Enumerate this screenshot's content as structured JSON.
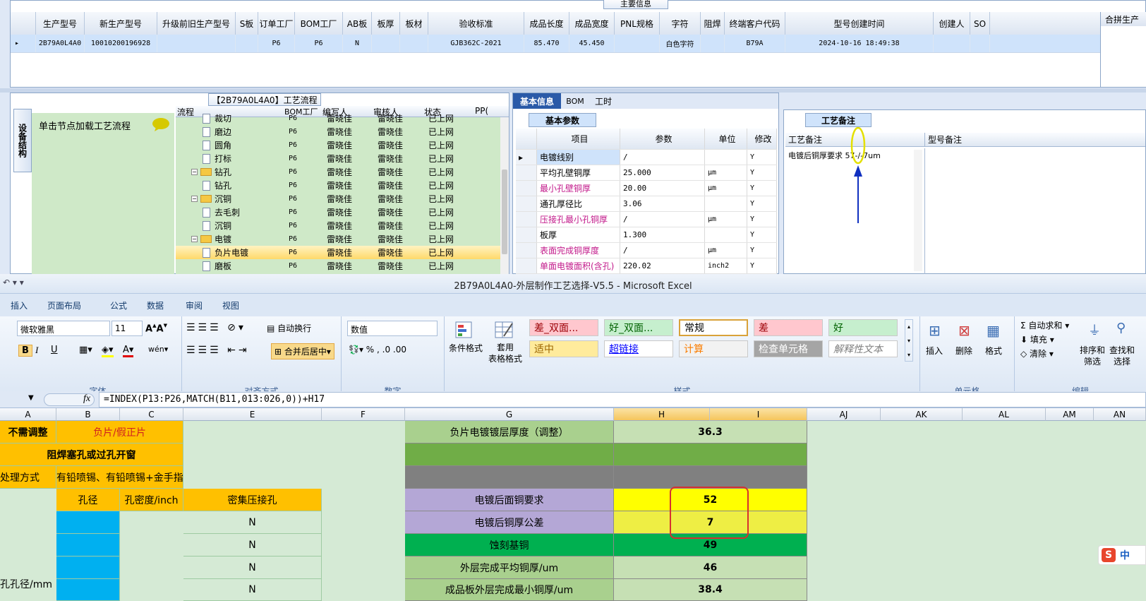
{
  "top_grid": {
    "panel_title": "主要信息",
    "headers": [
      "生产型号",
      "新生产型号",
      "升级前旧生产型号",
      "S板",
      "订单工厂",
      "BOM工厂",
      "AB板",
      "板厚",
      "板材",
      "验收标准",
      "成品长度",
      "成品宽度",
      "PNL规格",
      "字符",
      "阻焊",
      "终端客户代码",
      "型号创建时间",
      "创建人",
      "SO"
    ],
    "row": [
      "2B79A0L4A0",
      "10010200196928",
      "",
      "",
      "P6",
      "P6",
      "N",
      "",
      "",
      "GJB362C-2021",
      "85.470",
      "45.450",
      "",
      "白色字符",
      "",
      "B79A",
      "2024-10-16 18:49:38",
      "",
      ""
    ],
    "right_header": "合拼生产"
  },
  "flow": {
    "title": "【2B79A0L4A0】工艺流程",
    "side_tab": "设备结构",
    "hint": "单击节点加载工艺流程",
    "headers": [
      "流程",
      "BOM工厂",
      "编写人",
      "审核人",
      "状态",
      "PP("
    ],
    "rows": [
      {
        "name": "裁切",
        "bom": "P6",
        "writer": "雷晓佳",
        "reviewer": "雷晓佳",
        "status": "已上网",
        "type": "doc",
        "level": 2
      },
      {
        "name": "磨边",
        "bom": "P6",
        "writer": "雷晓佳",
        "reviewer": "雷晓佳",
        "status": "已上网",
        "type": "doc",
        "level": 2
      },
      {
        "name": "圆角",
        "bom": "P6",
        "writer": "雷晓佳",
        "reviewer": "雷晓佳",
        "status": "已上网",
        "type": "doc",
        "level": 2
      },
      {
        "name": "打标",
        "bom": "P6",
        "writer": "雷晓佳",
        "reviewer": "雷晓佳",
        "status": "已上网",
        "type": "doc",
        "level": 2
      },
      {
        "name": "钻孔",
        "bom": "P6",
        "writer": "雷晓佳",
        "reviewer": "雷晓佳",
        "status": "已上网",
        "type": "folder",
        "level": 1
      },
      {
        "name": "钻孔",
        "bom": "P6",
        "writer": "雷晓佳",
        "reviewer": "雷晓佳",
        "status": "已上网",
        "type": "doc",
        "level": 2
      },
      {
        "name": "沉铜",
        "bom": "P6",
        "writer": "雷晓佳",
        "reviewer": "雷晓佳",
        "status": "已上网",
        "type": "folder",
        "level": 1
      },
      {
        "name": "去毛刺",
        "bom": "P6",
        "writer": "雷晓佳",
        "reviewer": "雷晓佳",
        "status": "已上网",
        "type": "doc",
        "level": 2
      },
      {
        "name": "沉铜",
        "bom": "P6",
        "writer": "雷晓佳",
        "reviewer": "雷晓佳",
        "status": "已上网",
        "type": "doc",
        "level": 2
      },
      {
        "name": "电镀",
        "bom": "P6",
        "writer": "雷晓佳",
        "reviewer": "雷晓佳",
        "status": "已上网",
        "type": "folder",
        "level": 1
      },
      {
        "name": "负片电镀",
        "bom": "P6",
        "writer": "雷晓佳",
        "reviewer": "雷晓佳",
        "status": "已上网",
        "type": "doc",
        "level": 2
      },
      {
        "name": "磨板",
        "bom": "P6",
        "writer": "雷晓佳",
        "reviewer": "雷晓佳",
        "status": "已上网",
        "type": "doc",
        "level": 2
      }
    ]
  },
  "info": {
    "tabs": [
      "基本信息",
      "BOM",
      "工时"
    ],
    "subtab": "基本参数",
    "headers": [
      "项目",
      "参数",
      "单位",
      "修改"
    ],
    "rows": [
      {
        "item": "电镀线别",
        "param": "/",
        "unit": "",
        "mod": "Y",
        "pink": false
      },
      {
        "item": "平均孔壁铜厚",
        "param": "25.000",
        "unit": "μm",
        "mod": "Y",
        "pink": false
      },
      {
        "item": "最小孔壁铜厚",
        "param": "20.00",
        "unit": "μm",
        "mod": "Y",
        "pink": true
      },
      {
        "item": "通孔厚径比",
        "param": "3.06",
        "unit": "",
        "mod": "Y",
        "pink": false
      },
      {
        "item": "压接孔最小孔铜厚",
        "param": "/",
        "unit": "μm",
        "mod": "Y",
        "pink": true
      },
      {
        "item": "板厚",
        "param": "1.300",
        "unit": "",
        "mod": "Y",
        "pink": false
      },
      {
        "item": "表面完成铜厚度",
        "param": "/",
        "unit": "μm",
        "mod": "Y",
        "pink": true
      },
      {
        "item": "单面电镀面积(含孔)",
        "param": "220.02",
        "unit": "inch2",
        "mod": "Y",
        "pink": true
      }
    ]
  },
  "notes": {
    "tab": "工艺备注",
    "col1": "工艺备注",
    "col2": "型号备注",
    "text": "电镀后铜厚要求 57-/-7um"
  },
  "excel": {
    "title": "2B79A0L4A0-外层制作工艺选择-V5.5 - Microsoft Excel",
    "ribbon_tabs": [
      "插入",
      "页面布局",
      "公式",
      "数据",
      "审阅",
      "视图"
    ],
    "font_name": "微软雅黑",
    "font_size": "11",
    "wrap": "自动换行",
    "merge": "合并后居中",
    "number_format": "数值",
    "cond_format": "条件格式",
    "table_format": "套用\n表格格式",
    "styles": [
      {
        "t": "差_双面...",
        "bg": "#ffc7ce",
        "c": "#9c0006"
      },
      {
        "t": "好_双面...",
        "bg": "#c6efce",
        "c": "#006100"
      },
      {
        "t": "常规",
        "bg": "#ffffff",
        "c": "#000000"
      },
      {
        "t": "差",
        "bg": "#ffc7ce",
        "c": "#9c0006"
      },
      {
        "t": "好",
        "bg": "#c6efce",
        "c": "#006100"
      },
      {
        "t": "适中",
        "bg": "#ffeb9c",
        "c": "#9c6500"
      },
      {
        "t": "超链接",
        "bg": "#ffffff",
        "c": "#0000ff"
      },
      {
        "t": "计算",
        "bg": "#f2f2f2",
        "c": "#fa7d00"
      },
      {
        "t": "检查单元格",
        "bg": "#a5a5a5",
        "c": "#ffffff"
      },
      {
        "t": "解释性文本",
        "bg": "#ffffff",
        "c": "#7f7f7f"
      }
    ],
    "cells_group": [
      "插入",
      "删除",
      "格式"
    ],
    "edit_group": [
      "自动求和",
      "填充",
      "清除"
    ],
    "sort": "排序和\n筛选",
    "find": "查找和\n选择",
    "group_labels": [
      "字体",
      "对齐方式",
      "数字",
      "样式",
      "单元格",
      "编辑"
    ],
    "formula": "=INDEX(P13:P26,MATCH(B11,013:026,0))+H17",
    "cols": [
      "A",
      "B",
      "C",
      "E",
      "F",
      "G",
      "H",
      "I",
      "AJ",
      "AK",
      "AL",
      "AM",
      "AN"
    ],
    "cells": {
      "a1": "不需调整",
      "b1": "负片/假正片",
      "ab2": "阻焊塞孔或过孔开窗",
      "a3": "处理方式",
      "b3": "有铅喷锡、有铅喷锡+金手指",
      "b4": "孔径",
      "c4": "孔密度/inch",
      "e4": "密集压接孔",
      "n": [
        "N",
        "N",
        "N",
        "N"
      ],
      "a7": "孔孔径/mm",
      "g1": "负片电镀镀层厚度（调整）",
      "h1": "36.3",
      "g4": "电镀后面铜要求",
      "h4": "52",
      "g5": "电镀后铜厚公差",
      "h5": "7",
      "g6": "蚀刻基铜",
      "h6": "49",
      "g7": "外层完成平均铜厚/um",
      "h7": "46",
      "g8": "成品板外层完成最小铜厚/um",
      "h8": "38.4"
    }
  },
  "ime": "中"
}
